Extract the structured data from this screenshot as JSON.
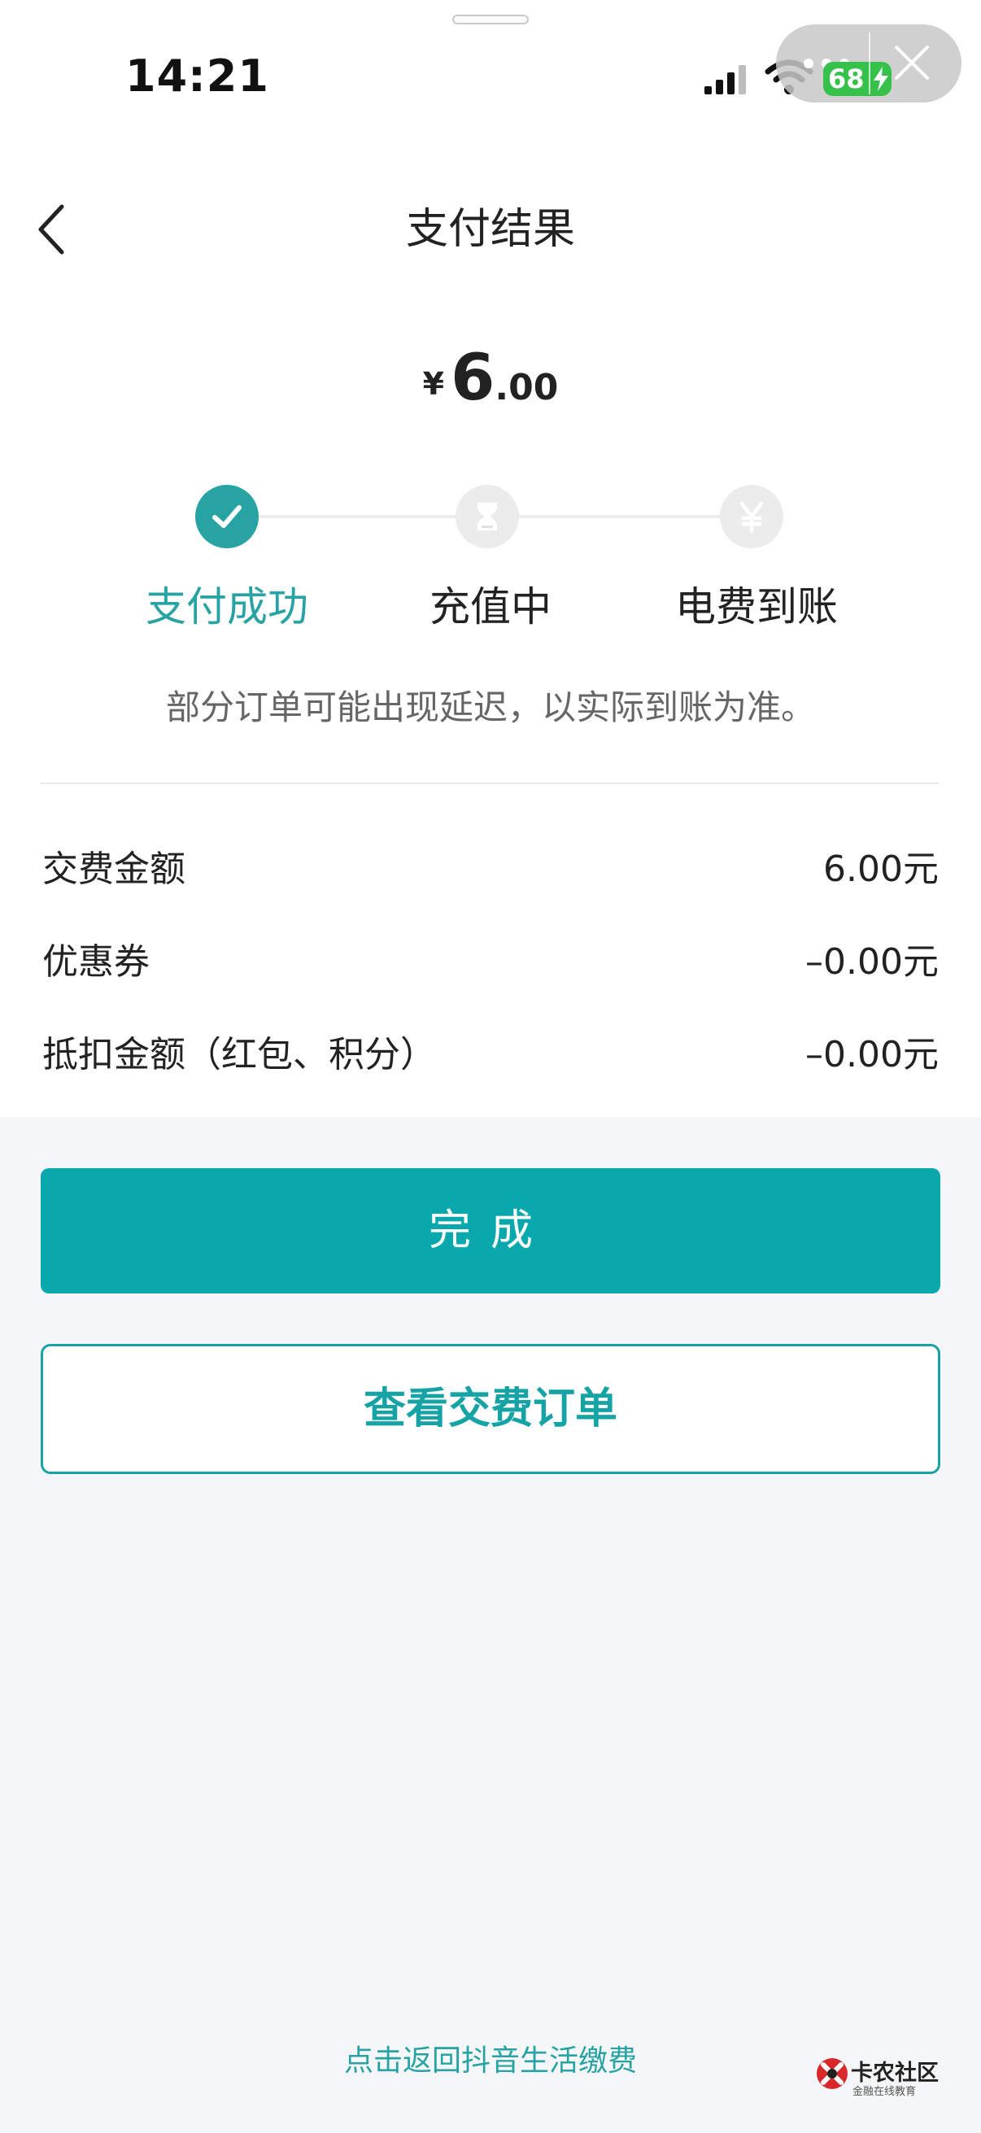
{
  "status_bar": {
    "time": "14:21",
    "battery": "68"
  },
  "header": {
    "title": "支付结果"
  },
  "amount": {
    "currency_symbol": "¥",
    "integer": "6",
    "decimal": ".00"
  },
  "steps": [
    {
      "label": "支付成功",
      "state": "done",
      "icon": "check-icon"
    },
    {
      "label": "充值中",
      "state": "pending",
      "icon": "hourglass-icon"
    },
    {
      "label": "电费到账",
      "state": "pending",
      "icon": "yen-icon"
    }
  ],
  "note": "部分订单可能出现延迟，以实际到账为准。",
  "details": [
    {
      "label": "交费金额",
      "value": "6.00元"
    },
    {
      "label": "优惠券",
      "value": "–0.00元"
    },
    {
      "label": "抵扣金额（红包、积分）",
      "value": "–0.00元"
    }
  ],
  "buttons": {
    "done": "完成",
    "view_order": "查看交费订单"
  },
  "footer": {
    "back_link": "点击返回抖音生活缴费"
  },
  "watermark": {
    "title": "卡农社区",
    "subtitle": "金融在线教育"
  },
  "colors": {
    "accent": "#27a3a3",
    "button": "#09a8ad",
    "battery": "#36c14a"
  }
}
